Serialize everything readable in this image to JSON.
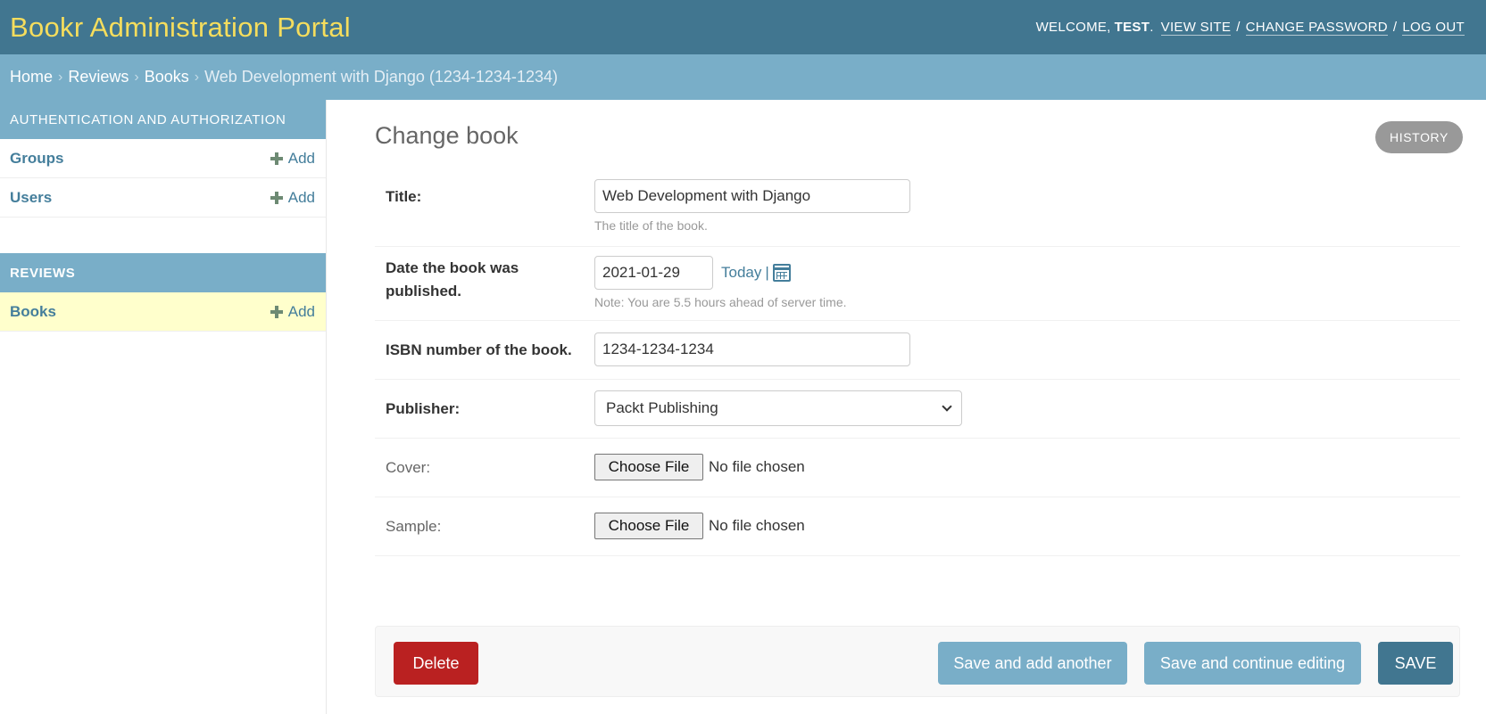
{
  "header": {
    "brand": "Bookr Administration Portal",
    "welcome": "WELCOME,",
    "username": "TEST",
    "view_site": "VIEW SITE",
    "change_password": "CHANGE PASSWORD",
    "log_out": "LOG OUT",
    "separator": "/"
  },
  "breadcrumbs": {
    "items": [
      "Home",
      "Reviews",
      "Books"
    ],
    "current": "Web Development with Django (1234-1234-1234)",
    "separator": "›"
  },
  "sidebar": {
    "modules": [
      {
        "caption": "AUTHENTICATION AND AUTHORIZATION",
        "models": [
          {
            "name": "Groups",
            "add": "Add"
          },
          {
            "name": "Users",
            "add": "Add"
          }
        ]
      },
      {
        "caption": "REVIEWS",
        "models": [
          {
            "name": "Books",
            "add": "Add",
            "active": true
          }
        ]
      }
    ]
  },
  "main": {
    "title": "Change book",
    "history": "HISTORY",
    "fields": {
      "title": {
        "label": "Title:",
        "value": "Web Development with Django",
        "help": "The title of the book."
      },
      "publication_date": {
        "label": "Date the book was published.",
        "value": "2021-01-29",
        "today": "Today",
        "bar": "|",
        "note": "Note: You are 5.5 hours ahead of server time."
      },
      "isbn": {
        "label": "ISBN number of the book.",
        "value": "1234-1234-1234"
      },
      "publisher": {
        "label": "Publisher:",
        "selected": "Packt Publishing"
      },
      "cover": {
        "label": "Cover:",
        "button": "Choose File",
        "status": "No file chosen"
      },
      "sample": {
        "label": "Sample:",
        "button": "Choose File",
        "status": "No file chosen"
      }
    },
    "actions": {
      "delete": "Delete",
      "save_add_another": "Save and add another",
      "save_continue": "Save and continue editing",
      "save": "SAVE"
    }
  },
  "colors": {
    "header": "#417690",
    "brand": "#f5dd5d",
    "breadcrumbs": "#79aec8",
    "link": "#447e9b",
    "delete": "#ba2121",
    "active_row": "#ffffcc"
  }
}
